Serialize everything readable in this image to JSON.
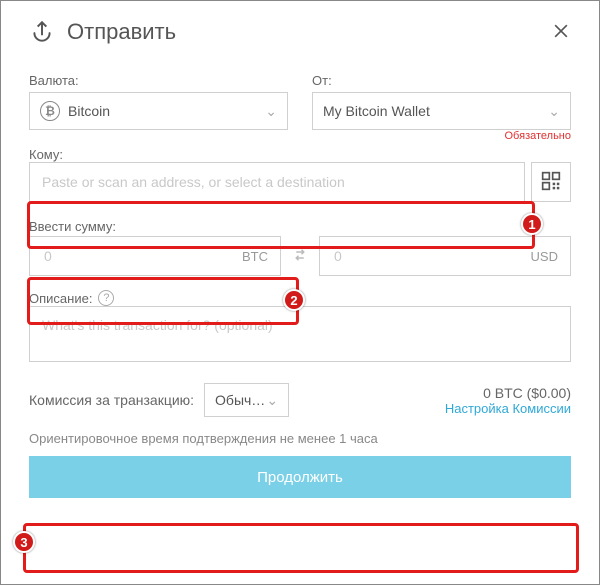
{
  "header": {
    "title": "Отправить"
  },
  "currency": {
    "label": "Валюта:",
    "selected": "Bitcoin"
  },
  "from": {
    "label": "От:",
    "selected": "My Bitcoin Wallet"
  },
  "to": {
    "label": "Кому:",
    "required_text": "Обязательно",
    "placeholder": "Paste or scan an address, or select a destination"
  },
  "amount": {
    "label": "Ввести сумму:",
    "crypto_placeholder": "0",
    "crypto_suffix": "BTC",
    "fiat_placeholder": "0",
    "fiat_suffix": "USD"
  },
  "description": {
    "label": "Описание:",
    "placeholder": "What's this transaction for? (optional)"
  },
  "fee": {
    "label": "Комиссия за транзакцию:",
    "selector": "Обыч…",
    "amount": "0 BTC ($0.00)",
    "settings_link": "Настройка Комиссии"
  },
  "eta": "Ориентировочное время подтверждения не менее 1 часа",
  "continue_button": "Продолжить",
  "annotations": {
    "b1": "1",
    "b2": "2",
    "b3": "3"
  }
}
